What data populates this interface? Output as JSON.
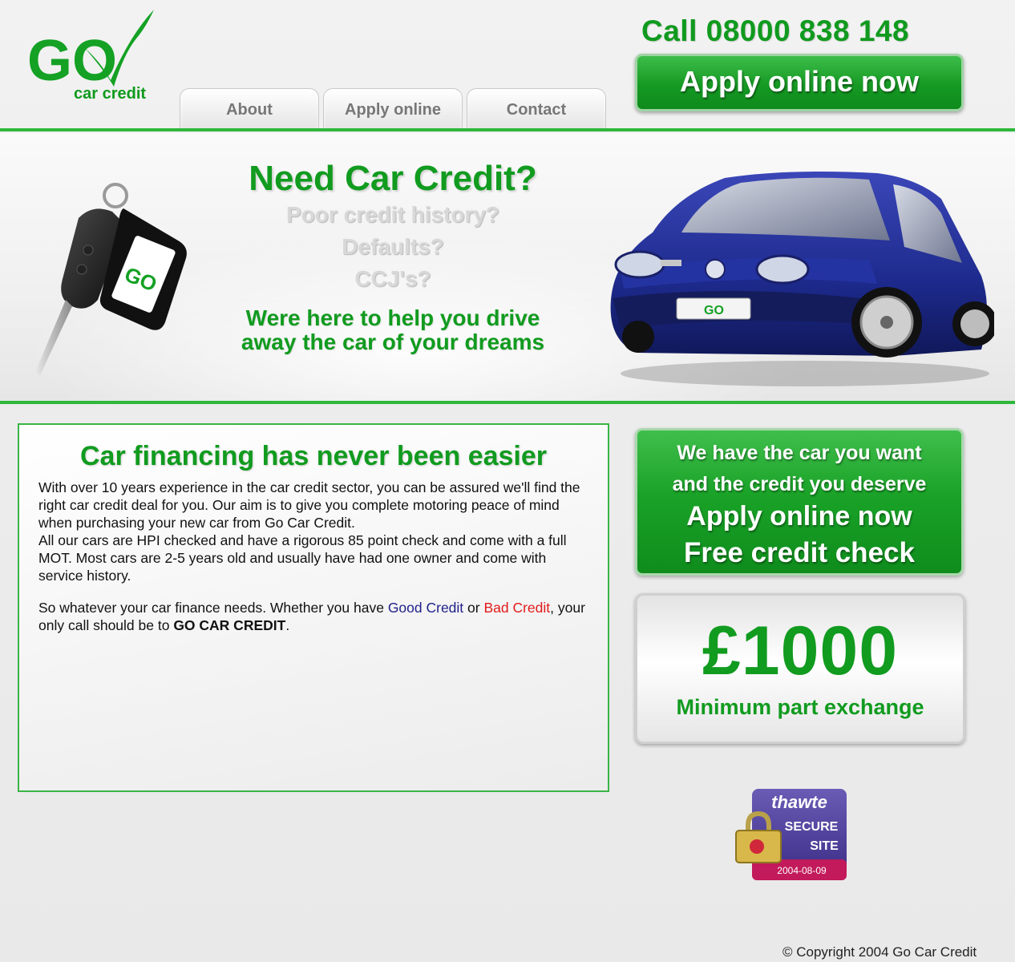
{
  "header": {
    "logo_text": "GO",
    "logo_tagline": "car credit",
    "phone": "Call 08000 838 148",
    "apply_button": "Apply online now"
  },
  "nav": {
    "tabs": [
      {
        "label": "About"
      },
      {
        "label": "Apply online"
      },
      {
        "label": "Contact"
      }
    ]
  },
  "hero": {
    "title": "Need Car Credit?",
    "subtitles": [
      "Poor credit history?",
      "Defaults?",
      "CCJ's?"
    ],
    "tagline_line1": "Were here to help you drive",
    "tagline_line2": "away the car of your dreams"
  },
  "content": {
    "title": "Car financing has never been easier",
    "paragraph1": "With over 10 years experience in the car credit sector, you can be assured we'll find the right car credit deal for you. Our aim is to give you complete motoring peace of mind when purchasing your new car from Go Car Credit.",
    "paragraph2": "All our cars are HPI checked and have a rigorous 85 point check and come with a full MOT. Most cars are 2-5 years old and usually have had one owner and come with service history.",
    "p3_prefix": "So whatever your car finance needs. Whether you have ",
    "p3_good": "Good Credit",
    "p3_or": " or ",
    "p3_bad": "Bad Credit",
    "p3_mid": ", your only call should be to ",
    "p3_brand": "GO CAR CREDIT",
    "p3_end": "."
  },
  "promo": {
    "line1": "We have the car you want",
    "line2": "and the credit you deserve",
    "line3": "Apply online now",
    "line4": "Free credit check"
  },
  "exchange": {
    "amount": "£1000",
    "label": "Minimum part exchange"
  },
  "badge": {
    "brand": "thawte",
    "line1": "SECURE",
    "line2": "SITE",
    "date": "2004-08-09"
  },
  "footer": {
    "copyright": "© Copyright 2004 Go Car Credit"
  },
  "colors": {
    "brand_green": "#119b1f",
    "button_green": "#1aa328",
    "bad_red": "#e21a1a",
    "good_navy": "#1f1f8a"
  }
}
